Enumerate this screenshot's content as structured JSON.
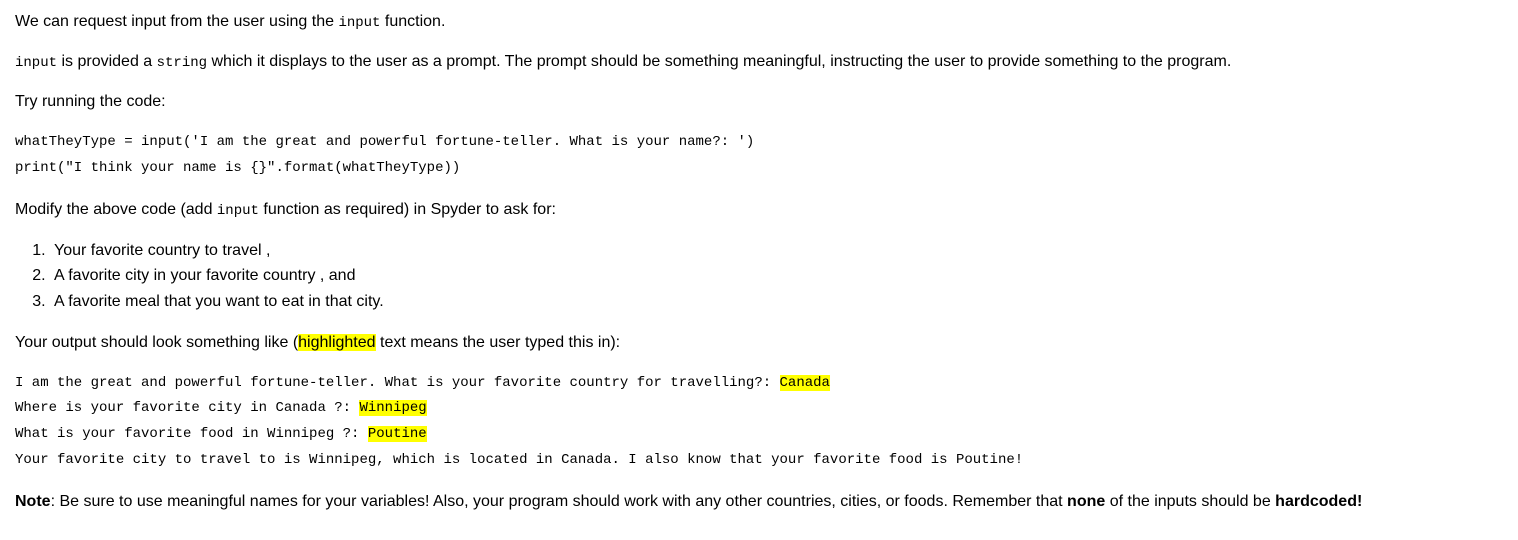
{
  "p1": {
    "pre": "We can request input from the user using the ",
    "code": "input",
    "post": " function."
  },
  "p2": {
    "code1": "input",
    "mid1": " is provided a ",
    "code2": "string",
    "post": " which it displays to the user as a prompt. The prompt should be something meaningful, instructing the user to provide something to the program."
  },
  "p3": "Try running the code:",
  "code_example": "whatTheyType = input('I am the great and powerful fortune-teller. What is your name?: ')\nprint(\"I think your name is {}\".format(whatTheyType))",
  "p4": {
    "pre": "Modify the above code (add ",
    "code": "input",
    "post": " function as required) in Spyder to ask for:"
  },
  "list": [
    "Your favorite country to travel ,",
    "A favorite city in your favorite country , and",
    "A favorite meal that you want to eat in that city."
  ],
  "p5": {
    "pre": "Your output should look something like (",
    "hl": "highlighted",
    "post": " text means the user typed this in):"
  },
  "output": {
    "line1": {
      "prompt": "I am the great and powerful fortune-teller. What is your favorite country for travelling?: ",
      "user": "Canada"
    },
    "line2": {
      "prompt": "Where is your favorite city in Canada ?: ",
      "user": "Winnipeg"
    },
    "line3": {
      "prompt": "What is your favorite food in Winnipeg ?: ",
      "user": "Poutine"
    },
    "line4": "Your favorite city to travel to is Winnipeg, which is located in Canada. I also know that your favorite food is Poutine!"
  },
  "note": {
    "label": "Note",
    "mid1": ": Be sure to use meaningful names for your variables! Also, your program should work with any other countries, cities, or foods. Remember that ",
    "strong1": "none",
    "mid2": " of the inputs should be ",
    "strong2": "hardcoded!"
  }
}
